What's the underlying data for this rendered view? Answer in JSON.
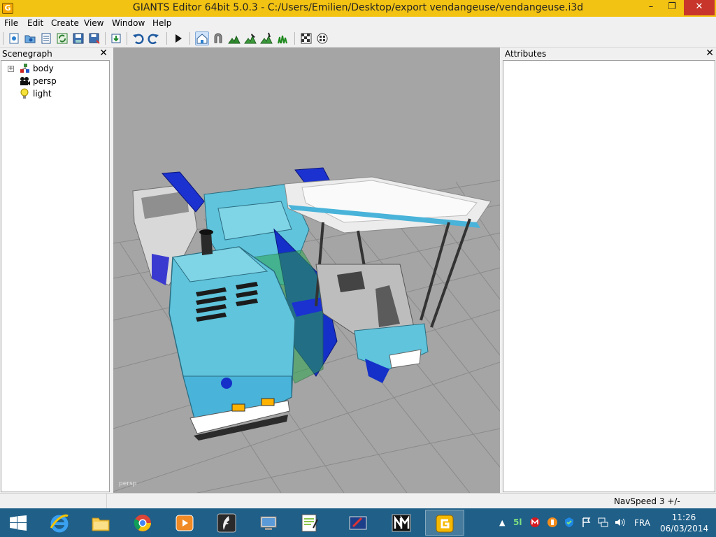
{
  "window": {
    "title": "GIANTS Editor 64bit 5.0.3 - C:/Users/Emilien/Desktop/export vendangeuse/vendangeuse.i3d",
    "app_icon_letter": "G",
    "minimize_glyph": "–",
    "maximize_glyph": "❐",
    "close_glyph": "✕"
  },
  "menu": [
    {
      "label": "File"
    },
    {
      "label": "Edit"
    },
    {
      "label": "Create"
    },
    {
      "label": "View"
    },
    {
      "label": "Window"
    },
    {
      "label": "Help"
    }
  ],
  "toolbar": {
    "items": [
      {
        "icon": "new-scene-icon"
      },
      {
        "icon": "open-scene-icon"
      },
      {
        "icon": "file-list-icon"
      },
      {
        "icon": "refresh-icon"
      },
      {
        "icon": "save-icon"
      },
      {
        "icon": "save-as-icon"
      },
      {
        "icon": "import-icon"
      },
      {
        "icon": "undo-icon"
      },
      {
        "icon": "redo-icon"
      },
      {
        "icon": "play-icon"
      },
      {
        "icon": "select-tool-icon",
        "active": true
      },
      {
        "icon": "magnet-icon"
      },
      {
        "icon": "terrain-sculpt-icon"
      },
      {
        "icon": "terrain-paint-icon"
      },
      {
        "icon": "foliage-paint-icon"
      },
      {
        "icon": "foliage-grass-icon"
      },
      {
        "icon": "render-settings-icon"
      },
      {
        "icon": "scene-statistics-icon"
      }
    ]
  },
  "scenegraph": {
    "title": "Scenegraph",
    "close_glyph": "✕",
    "items": [
      {
        "label": "body",
        "icon": "transform-group-icon",
        "expander": "+"
      },
      {
        "label": "persp",
        "icon": "camera-icon"
      },
      {
        "label": "light",
        "icon": "light-bulb-icon"
      }
    ]
  },
  "attributes": {
    "title": "Attributes",
    "close_glyph": "✕"
  },
  "viewport": {
    "camera_label": "persp",
    "background": "#a5a5a5"
  },
  "statusbar": {
    "navspeed": "NavSpeed 3 +/-"
  },
  "taskbar": {
    "apps": [
      {
        "icon": "internet-explorer-icon"
      },
      {
        "icon": "file-explorer-icon"
      },
      {
        "icon": "chrome-icon"
      },
      {
        "icon": "media-player-icon"
      },
      {
        "icon": "feather-app-icon"
      },
      {
        "icon": "network-monitor-icon"
      },
      {
        "icon": "notepad-plus-icon"
      },
      {
        "icon": "pen-tablet-icon"
      },
      {
        "icon": "n-media-app-icon"
      },
      {
        "icon": "giants-editor-icon",
        "active": true
      }
    ],
    "tray": {
      "badge_text": "5l",
      "language": "FRA",
      "time": "11:26",
      "date": "06/03/2014"
    }
  },
  "colors": {
    "titlebar": "#f3c313",
    "close_button": "#c7352b",
    "taskbar": "#1f5f88",
    "machine_cyan": "#5fc4dc",
    "machine_blue": "#1430c8"
  }
}
